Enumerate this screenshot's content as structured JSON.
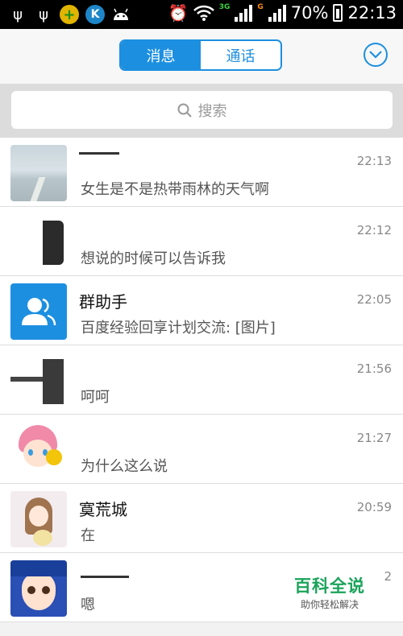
{
  "status": {
    "battery": "70%",
    "time": "22:13",
    "net1": "3G",
    "net2": "G"
  },
  "tabs": {
    "messages": "消息",
    "calls": "通话"
  },
  "search": {
    "placeholder": "搜索"
  },
  "conversations": [
    {
      "name": "",
      "preview": "女生是不是热带雨林的天气啊",
      "time": "22:13"
    },
    {
      "name": "",
      "preview": "想说的时候可以告诉我",
      "time": "22:12"
    },
    {
      "name": "群助手",
      "preview": "百度经验回享计划交流: [图片]",
      "time": "22:05"
    },
    {
      "name": "",
      "preview": "呵呵",
      "time": "21:56"
    },
    {
      "name": "",
      "preview": "为什么这么说",
      "time": "21:27"
    },
    {
      "name": "寞荒城",
      "preview": "在",
      "time": "20:59"
    },
    {
      "name": "",
      "preview": "嗯",
      "time": "2"
    }
  ],
  "watermark": {
    "title": "百科全说",
    "subtitle": "助你轻松解决"
  },
  "colors": {
    "accent": "#1d8fe0",
    "watermark": "#1aa35a"
  }
}
